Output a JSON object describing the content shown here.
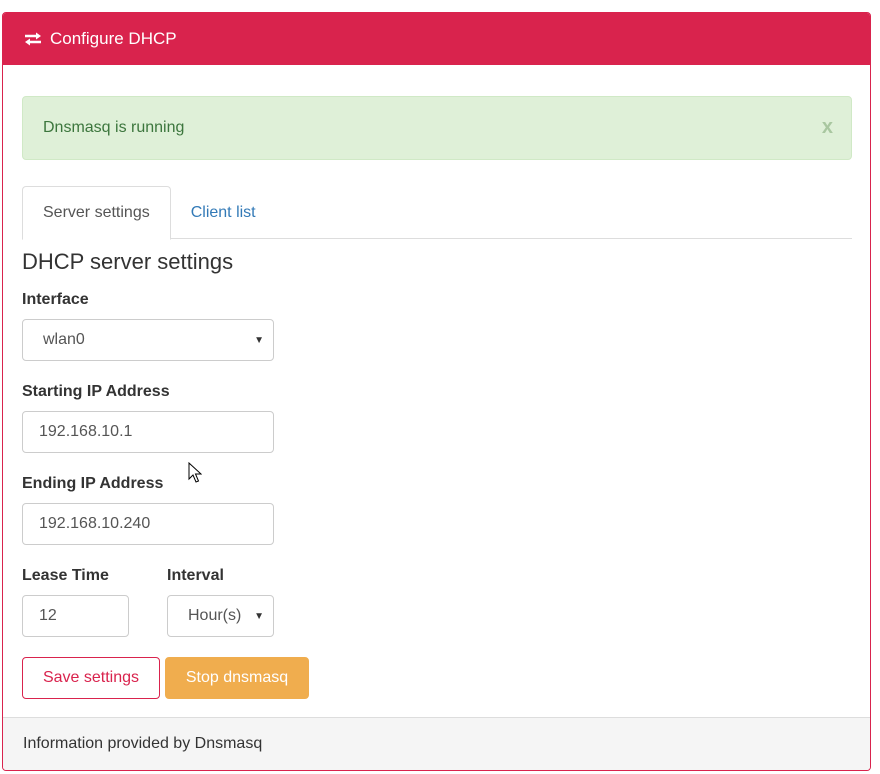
{
  "header": {
    "title": "Configure DHCP",
    "icon": "exchange-arrows-icon"
  },
  "alert": {
    "message": "Dnsmasq is running",
    "close_label": "x"
  },
  "tabs": [
    {
      "label": "Server settings",
      "active": true
    },
    {
      "label": "Client list",
      "active": false
    }
  ],
  "form": {
    "title": "DHCP server settings",
    "interface": {
      "label": "Interface",
      "value": "wlan0"
    },
    "start_ip": {
      "label": "Starting IP Address",
      "value": "192.168.10.1"
    },
    "end_ip": {
      "label": "Ending IP Address",
      "value": "192.168.10.240"
    },
    "lease_time": {
      "label": "Lease Time",
      "value": "12"
    },
    "interval": {
      "label": "Interval",
      "value": "Hour(s)"
    }
  },
  "buttons": {
    "save": "Save settings",
    "stop": "Stop dnsmasq"
  },
  "footer": {
    "text": "Information provided by Dnsmasq"
  },
  "colors": {
    "brand": "#d9234d",
    "success_bg": "#dff0d8",
    "success_text": "#3c763d",
    "warning": "#f0ad4e",
    "link": "#337ab7"
  }
}
